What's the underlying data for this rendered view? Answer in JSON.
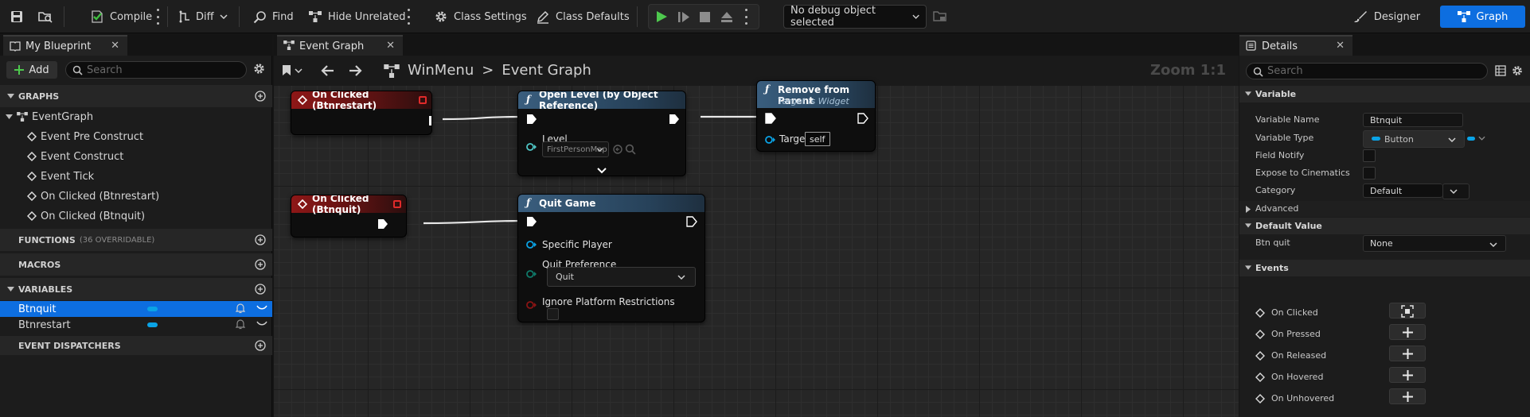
{
  "colors": {
    "accent": "#0d6ee0",
    "event_header": "#8e1717",
    "function_header": "#3a5e7e",
    "variable_pin": "#0aa3e6",
    "window_bg": "#151515"
  },
  "toolbar": {
    "compile_label": "Compile",
    "diff_label": "Diff",
    "find_label": "Find",
    "hide_unrelated_label": "Hide Unrelated",
    "class_settings_label": "Class Settings",
    "class_defaults_label": "Class Defaults",
    "debug_object": "No debug object selected",
    "designer_label": "Designer",
    "graph_label": "Graph"
  },
  "left": {
    "tab_title": "My Blueprint",
    "add_label": "Add",
    "search_placeholder": "Search",
    "graphs_header": "GRAPHS",
    "event_graph": "EventGraph",
    "events": [
      "Event Pre Construct",
      "Event Construct",
      "Event Tick",
      "On Clicked (Btnrestart)",
      "On Clicked (Btnquit)"
    ],
    "functions_header": "FUNCTIONS",
    "functions_count": "(36 OVERRIDABLE)",
    "macros_header": "MACROS",
    "variables_header": "VARIABLES",
    "variables": [
      "Btnquit",
      "Btnrestart"
    ],
    "dispatchers_header": "EVENT DISPATCHERS"
  },
  "graph": {
    "tab_title": "Event Graph",
    "breadcrumb_root": "WinMenu",
    "breadcrumb_sep": ">",
    "breadcrumb_leaf": "Event Graph",
    "zoom": "Zoom 1:1",
    "nodes": {
      "restart_event": "On Clicked (Btnrestart)",
      "open_level": "Open Level (by Object Reference)",
      "level_pin": "Level",
      "level_value": "FirstPersonMap",
      "remove_parent": "Remove from Parent",
      "remove_parent_sub": "Target is Widget",
      "target_pin": "Target",
      "target_value": "self",
      "quit_event": "On Clicked (Btnquit)",
      "quit_game": "Quit Game",
      "specific_player": "Specific Player",
      "quit_preference": "Quit Preference",
      "quit_value": "Quit",
      "ignore_platform": "Ignore Platform Restrictions"
    }
  },
  "details": {
    "tab_title": "Details",
    "search_placeholder": "Search",
    "variable_header": "Variable",
    "variable_name_label": "Variable Name",
    "variable_name_value": "Btnquit",
    "variable_type_label": "Variable Type",
    "variable_type_value": "Button",
    "field_notify": "Field Notify",
    "expose_cinematics": "Expose to Cinematics",
    "category_label": "Category",
    "category_value": "Default",
    "advanced": "Advanced",
    "default_value_header": "Default Value",
    "btn_quit_label": "Btn quit",
    "btn_quit_value": "None",
    "events_header": "Events",
    "events": [
      "On Clicked",
      "On Pressed",
      "On Released",
      "On Hovered",
      "On Unhovered"
    ]
  }
}
